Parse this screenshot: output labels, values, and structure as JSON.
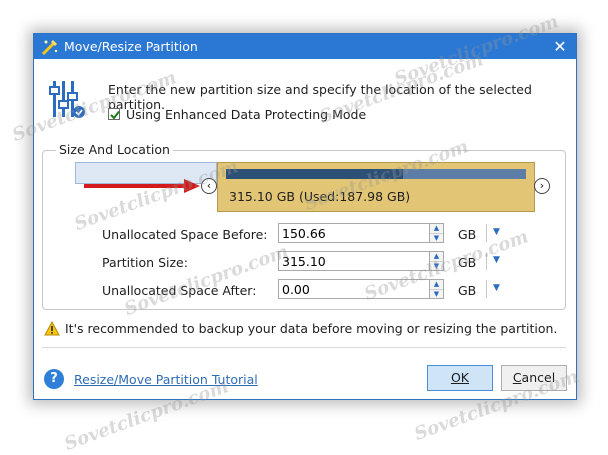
{
  "window": {
    "title": "Move/Resize Partition",
    "close_icon": "close-icon",
    "accent_color": "#2b78d4"
  },
  "intro": {
    "text": "Enter the new partition size and specify the location of the selected partition.",
    "checkbox_label": "Using Enhanced Data Protecting Mode",
    "checkbox_checked": true
  },
  "group": {
    "title": "Size And Location"
  },
  "partition_bar": {
    "label": "315.10 GB (Used:187.98 GB)",
    "left_handle": "‹",
    "right_handle": "›",
    "partition_color": "#e2c676",
    "used_color": "#2d5077",
    "unallocated_color": "#dde8f4"
  },
  "fields": [
    {
      "label": "Unallocated Space Before:",
      "value": "150.66",
      "unit": "GB"
    },
    {
      "label": "Partition Size:",
      "value": "315.10",
      "unit": "GB"
    },
    {
      "label": "Unallocated Space After:",
      "value": "0.00",
      "unit": "GB"
    }
  ],
  "warning": {
    "text": "It's recommended to backup your data before moving or resizing the partition.",
    "icon": "warning-icon"
  },
  "footer": {
    "help_icon_glyph": "?",
    "tutorial_link": "Resize/Move Partition Tutorial",
    "ok_label": "OK",
    "cancel_label_prefix": "C",
    "cancel_label_rest": "ancel"
  },
  "watermark_text": "Sovetclicpro.com"
}
